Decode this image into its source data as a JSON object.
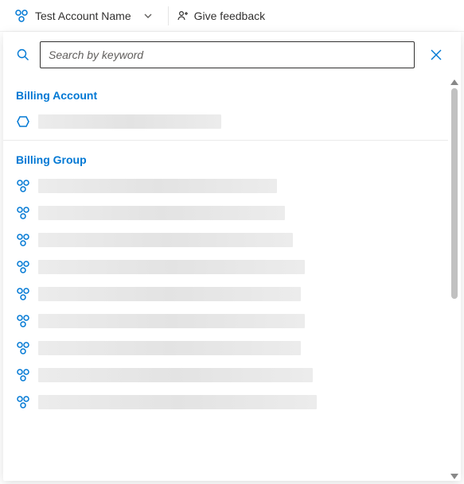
{
  "colors": {
    "accent": "#0078d4",
    "text": "#323130",
    "placeholder": "#605e5c"
  },
  "topbar": {
    "account_label": "Test Account Name",
    "feedback_label": "Give feedback"
  },
  "search": {
    "placeholder": "Search by keyword",
    "value": ""
  },
  "sections": {
    "billing_account": {
      "title": "Billing Account",
      "items": [
        {
          "label": "",
          "redacted_width": 230
        }
      ]
    },
    "billing_group": {
      "title": "Billing Group",
      "items": [
        {
          "label": "",
          "redacted_width": 300
        },
        {
          "label": "",
          "redacted_width": 310
        },
        {
          "label": "",
          "redacted_width": 320
        },
        {
          "label": "",
          "redacted_width": 335
        },
        {
          "label": "",
          "redacted_width": 330
        },
        {
          "label": "",
          "redacted_width": 335
        },
        {
          "label": "",
          "redacted_width": 330
        },
        {
          "label": "",
          "redacted_width": 345
        },
        {
          "label": "",
          "redacted_width": 350
        }
      ]
    }
  }
}
